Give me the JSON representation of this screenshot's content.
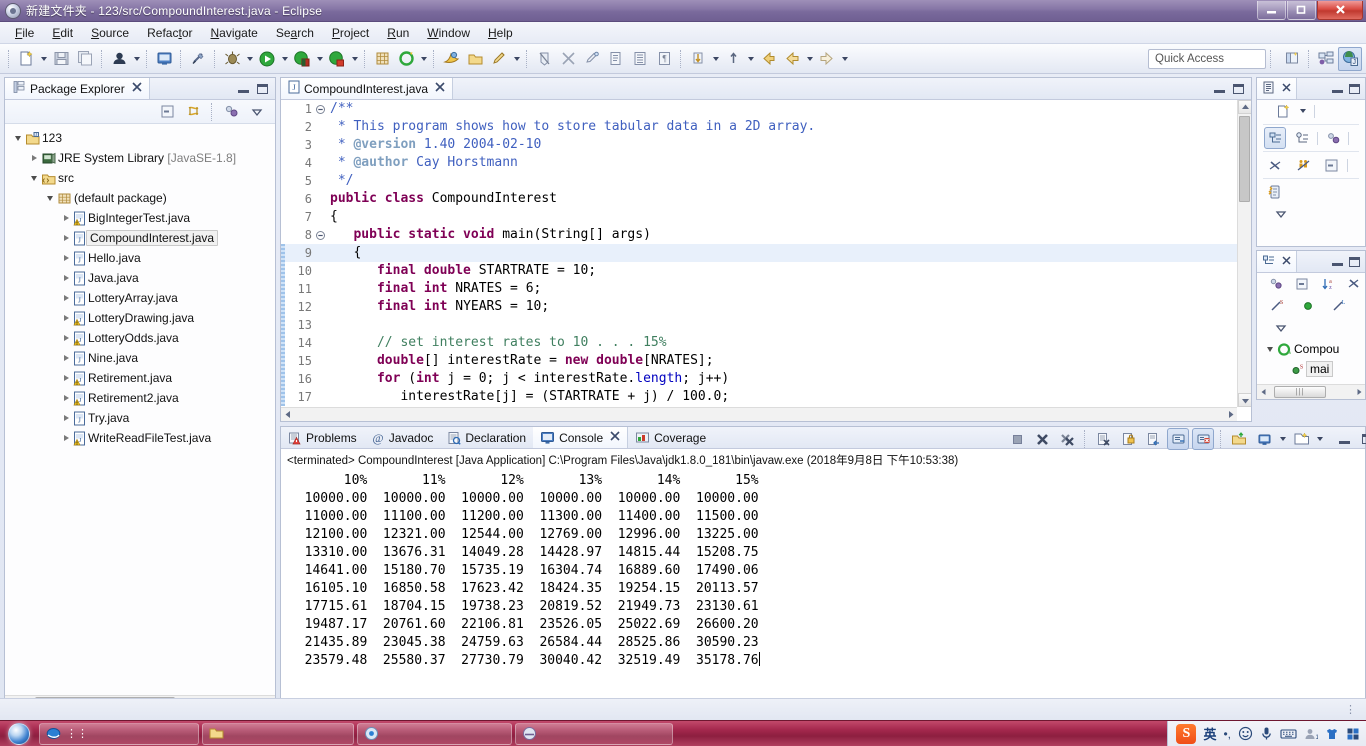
{
  "window": {
    "title": "新建文件夹 - 123/src/CompoundInterest.java - Eclipse",
    "icon": "eclipse-icon",
    "minimize_label": "—",
    "restore_label": "❐",
    "close_label": "✕"
  },
  "menubar": {
    "items": [
      {
        "label": "File",
        "mnemonic": "F"
      },
      {
        "label": "Edit",
        "mnemonic": "E"
      },
      {
        "label": "Source",
        "mnemonic": "S"
      },
      {
        "label": "Refactor",
        "mnemonic": "t"
      },
      {
        "label": "Navigate",
        "mnemonic": "N"
      },
      {
        "label": "Search",
        "mnemonic": "a"
      },
      {
        "label": "Project",
        "mnemonic": "P"
      },
      {
        "label": "Run",
        "mnemonic": "R"
      },
      {
        "label": "Window",
        "mnemonic": "W"
      },
      {
        "label": "Help",
        "mnemonic": "H"
      }
    ]
  },
  "toolbar": {
    "quick_access_placeholder": "Quick Access",
    "buttons": [
      "new-wizard-icon",
      "save-icon",
      "save-all-icon",
      "print-icon",
      "new-java-class-icon",
      "toggle-mark-occurrences-icon",
      "debug-icon",
      "run-icon",
      "run-coverage-icon",
      "run-external-tools-icon",
      "new-java-project-icon",
      "open-type-icon",
      "search-icon",
      "open-task-icon",
      "pencil-icon",
      "skip-breakpoints-icon",
      "next-annotation-icon",
      "previous-annotation-icon",
      "last-edit-location-icon",
      "back-icon",
      "forward-icon"
    ],
    "perspective_buttons": [
      "open-perspective-icon",
      "java-ee-perspective-icon",
      "java-perspective-icon"
    ]
  },
  "package_explorer": {
    "tab_label": "Package Explorer",
    "close_label": "✕",
    "toolbar_icons": [
      "collapse-all-icon",
      "link-with-editor-icon",
      "focus-on-active-task-icon",
      "view-menu-icon"
    ],
    "tree": [
      {
        "indent": 0,
        "twist": "open",
        "icon": "java-project-icon",
        "label": "123",
        "suffix": "",
        "selected": false
      },
      {
        "indent": 1,
        "twist": "closed",
        "icon": "jre-library-icon",
        "label": "JRE System Library",
        "suffix": " [JavaSE-1.8]",
        "selected": false
      },
      {
        "indent": 1,
        "twist": "open",
        "icon": "source-folder-icon",
        "label": "src",
        "suffix": "",
        "selected": false
      },
      {
        "indent": 2,
        "twist": "open",
        "icon": "package-icon",
        "label": "(default package)",
        "suffix": "",
        "selected": false
      },
      {
        "indent": 3,
        "twist": "closed",
        "icon": "java-file-warn-icon",
        "label": "BigIntegerTest.java",
        "suffix": "",
        "selected": false
      },
      {
        "indent": 3,
        "twist": "closed",
        "icon": "java-file-icon",
        "label": "CompoundInterest.java",
        "suffix": "",
        "selected": true
      },
      {
        "indent": 3,
        "twist": "closed",
        "icon": "java-file-icon",
        "label": "Hello.java",
        "suffix": "",
        "selected": false
      },
      {
        "indent": 3,
        "twist": "closed",
        "icon": "java-file-icon",
        "label": "Java.java",
        "suffix": "",
        "selected": false
      },
      {
        "indent": 3,
        "twist": "closed",
        "icon": "java-file-icon",
        "label": "LotteryArray.java",
        "suffix": "",
        "selected": false
      },
      {
        "indent": 3,
        "twist": "closed",
        "icon": "java-file-warn-icon",
        "label": "LotteryDrawing.java",
        "suffix": "",
        "selected": false
      },
      {
        "indent": 3,
        "twist": "closed",
        "icon": "java-file-warn-icon",
        "label": "LotteryOdds.java",
        "suffix": "",
        "selected": false
      },
      {
        "indent": 3,
        "twist": "closed",
        "icon": "java-file-icon",
        "label": "Nine.java",
        "suffix": "",
        "selected": false
      },
      {
        "indent": 3,
        "twist": "closed",
        "icon": "java-file-warn-icon",
        "label": "Retirement.java",
        "suffix": "",
        "selected": false
      },
      {
        "indent": 3,
        "twist": "closed",
        "icon": "java-file-warn-icon",
        "label": "Retirement2.java",
        "suffix": "",
        "selected": false
      },
      {
        "indent": 3,
        "twist": "closed",
        "icon": "java-file-icon",
        "label": "Try.java",
        "suffix": "",
        "selected": false
      },
      {
        "indent": 3,
        "twist": "closed",
        "icon": "java-file-warn-icon",
        "label": "WriteReadFileTest.java",
        "suffix": "",
        "selected": false
      }
    ]
  },
  "editor": {
    "tab_label": "CompoundInterest.java",
    "tab_icon": "java-file-icon",
    "close_label": "✕",
    "minimize_label": "—",
    "maximize_label": "❐",
    "lines": [
      {
        "num": 1,
        "fold": "minus",
        "hl": false,
        "tokens": [
          {
            "t": "/**",
            "c": "jd"
          }
        ]
      },
      {
        "num": 2,
        "fold": "",
        "hl": false,
        "tokens": [
          {
            "t": " * This program shows how to store tabular data in a 2D array.",
            "c": "jd"
          }
        ]
      },
      {
        "num": 3,
        "fold": "",
        "hl": false,
        "tokens": [
          {
            "t": " * ",
            "c": "jd"
          },
          {
            "t": "@version",
            "c": "jt"
          },
          {
            "t": " 1.40 2004-02-10",
            "c": "jd"
          }
        ]
      },
      {
        "num": 4,
        "fold": "",
        "hl": false,
        "tokens": [
          {
            "t": " * ",
            "c": "jd"
          },
          {
            "t": "@author",
            "c": "jt"
          },
          {
            "t": " Cay Horstmann",
            "c": "jd"
          }
        ]
      },
      {
        "num": 5,
        "fold": "",
        "hl": false,
        "tokens": [
          {
            "t": " */",
            "c": "jd"
          }
        ]
      },
      {
        "num": 6,
        "fold": "",
        "hl": false,
        "tokens": [
          {
            "t": "public class",
            "c": "k"
          },
          {
            "t": " CompoundInterest",
            "c": ""
          }
        ]
      },
      {
        "num": 7,
        "fold": "",
        "hl": false,
        "tokens": [
          {
            "t": "{",
            "c": ""
          }
        ]
      },
      {
        "num": 8,
        "fold": "minus",
        "hl": false,
        "tokens": [
          {
            "t": "   ",
            "c": ""
          },
          {
            "t": "public static void",
            "c": "k"
          },
          {
            "t": " main(String[] args)",
            "c": ""
          }
        ]
      },
      {
        "num": 9,
        "fold": "",
        "hl": true,
        "tokens": [
          {
            "t": "   {",
            "c": ""
          }
        ]
      },
      {
        "num": 10,
        "fold": "",
        "hl": false,
        "tokens": [
          {
            "t": "      ",
            "c": ""
          },
          {
            "t": "final double",
            "c": "k"
          },
          {
            "t": " STARTRATE = 10;",
            "c": ""
          }
        ]
      },
      {
        "num": 11,
        "fold": "",
        "hl": false,
        "tokens": [
          {
            "t": "      ",
            "c": ""
          },
          {
            "t": "final int",
            "c": "k"
          },
          {
            "t": " NRATES = 6;",
            "c": ""
          }
        ]
      },
      {
        "num": 12,
        "fold": "",
        "hl": false,
        "tokens": [
          {
            "t": "      ",
            "c": ""
          },
          {
            "t": "final int",
            "c": "k"
          },
          {
            "t": " NYEARS = 10;",
            "c": ""
          }
        ]
      },
      {
        "num": 13,
        "fold": "",
        "hl": false,
        "tokens": [
          {
            "t": "",
            "c": ""
          }
        ]
      },
      {
        "num": 14,
        "fold": "",
        "hl": false,
        "tokens": [
          {
            "t": "      ",
            "c": ""
          },
          {
            "t": "// set interest rates to 10 . . . 15%",
            "c": "cm"
          }
        ]
      },
      {
        "num": 15,
        "fold": "",
        "hl": false,
        "tokens": [
          {
            "t": "      ",
            "c": ""
          },
          {
            "t": "double",
            "c": "k"
          },
          {
            "t": "[] interestRate = ",
            "c": ""
          },
          {
            "t": "new double",
            "c": "k"
          },
          {
            "t": "[NRATES];",
            "c": ""
          }
        ]
      },
      {
        "num": 16,
        "fold": "",
        "hl": false,
        "tokens": [
          {
            "t": "      ",
            "c": ""
          },
          {
            "t": "for",
            "c": "k"
          },
          {
            "t": " (",
            "c": ""
          },
          {
            "t": "int",
            "c": "k"
          },
          {
            "t": " j = 0; j < interestRate.",
            "c": ""
          },
          {
            "t": "length",
            "c": "fl"
          },
          {
            "t": "; j++)",
            "c": ""
          }
        ]
      },
      {
        "num": 17,
        "fold": "",
        "hl": false,
        "tokens": [
          {
            "t": "         interestRate[j] = (STARTRATE + j) / 100.0;",
            "c": ""
          }
        ]
      }
    ]
  },
  "bottom_panel": {
    "tabs": [
      {
        "label": "Problems",
        "icon": "problems-icon",
        "active": false
      },
      {
        "label": "Javadoc",
        "icon": "javadoc-icon",
        "active": false
      },
      {
        "label": "Declaration",
        "icon": "declaration-icon",
        "active": false
      },
      {
        "label": "Console",
        "icon": "console-icon",
        "active": true
      },
      {
        "label": "Coverage",
        "icon": "coverage-icon",
        "active": false
      }
    ],
    "toolbar_icons": [
      "terminate-icon",
      "remove-launch-icon",
      "remove-all-terminated-icon",
      "clear-console-icon",
      "scroll-lock-icon",
      "word-wrap-icon",
      "pin-console-icon",
      "display-selected-console-icon",
      "open-console-icon",
      "new-console-view-icon",
      "minimize-icon",
      "maximize-icon"
    ],
    "console_header": "<terminated> CompoundInterest [Java Application] C:\\Program Files\\Java\\jdk1.8.0_181\\bin\\javaw.exe (2018年9月8日 下午10:53:38)"
  },
  "console_output": {
    "type": "table",
    "columns": [
      "10%",
      "11%",
      "12%",
      "13%",
      "14%",
      "15%"
    ],
    "rows": [
      [
        "10000.00",
        "10000.00",
        "10000.00",
        "10000.00",
        "10000.00",
        "10000.00"
      ],
      [
        "11000.00",
        "11100.00",
        "11200.00",
        "11300.00",
        "11400.00",
        "11500.00"
      ],
      [
        "12100.00",
        "12321.00",
        "12544.00",
        "12769.00",
        "12996.00",
        "13225.00"
      ],
      [
        "13310.00",
        "13676.31",
        "14049.28",
        "14428.97",
        "14815.44",
        "15208.75"
      ],
      [
        "14641.00",
        "15180.70",
        "15735.19",
        "16304.74",
        "16889.60",
        "17490.06"
      ],
      [
        "16105.10",
        "16850.58",
        "17623.42",
        "18424.35",
        "19254.15",
        "20113.57"
      ],
      [
        "17715.61",
        "18704.15",
        "19738.23",
        "20819.52",
        "21949.73",
        "23130.61"
      ],
      [
        "19487.17",
        "20761.60",
        "22106.81",
        "23526.05",
        "25022.69",
        "26600.20"
      ],
      [
        "21435.89",
        "23045.38",
        "24759.63",
        "26584.44",
        "28525.86",
        "30590.23"
      ],
      [
        "23579.48",
        "25580.37",
        "27730.79",
        "30040.42",
        "32519.49",
        "35178.76"
      ]
    ]
  },
  "right_panels": {
    "outline": {
      "tab_icon": "outline-icon",
      "close_label": "✕",
      "minimize_label": "—",
      "maximize_label": "❐",
      "toolbar_icons": [
        "new-icon",
        "alphabetical-sort-icon",
        "hide-fields-icon",
        "hide-static-icon",
        "hide-non-public-icon",
        "hide-local-types-icon",
        "focus-icon",
        "view-menu-icon"
      ]
    },
    "outline_tree": {
      "tab_icon": "outline2-icon",
      "close_label": "✕",
      "minimize_label": "—",
      "maximize_label": "❐",
      "toolbar_icons": [
        "link-icon",
        "collapse-icon",
        "sort-icon",
        "filter-icon",
        "static-icon",
        "public-icon",
        "local-icon"
      ],
      "nodes": [
        {
          "indent": 0,
          "twist": "open",
          "icon": "class-icon",
          "label": "Compou"
        },
        {
          "indent": 1,
          "twist": "none",
          "icon": "method-icon",
          "label": "mai",
          "badge": "S"
        }
      ]
    },
    "hscroll_present": true
  },
  "statusbar": {
    "dots": "⋮"
  },
  "taskbar": {
    "start_label": "start-orb",
    "items": [
      {
        "icon": "ie-icon",
        "label": ""
      },
      {
        "icon": "folder-icon",
        "label": ""
      },
      {
        "icon": "chrome-icon",
        "label": ""
      },
      {
        "icon": "eclipse-icon",
        "label": ""
      }
    ],
    "tray": [
      {
        "icon": "sogou-icon",
        "label": "S"
      },
      {
        "icon": "ime-chinese-icon",
        "label": "英"
      },
      {
        "icon": "ime-punct-icon",
        "label": "•,"
      },
      {
        "icon": "emoji-icon",
        "label": "☺"
      },
      {
        "icon": "microphone-icon",
        "label": "🎤"
      },
      {
        "icon": "keyboard-icon",
        "label": "⌨"
      },
      {
        "icon": "user-icon",
        "label": "👤"
      },
      {
        "icon": "skin-icon",
        "label": "👕"
      },
      {
        "icon": "toolbox-icon",
        "label": "▦"
      }
    ]
  },
  "colors": {
    "title_bar": "#7a6a9c",
    "accent": "#6f5f92",
    "taskbar": "#a4284d",
    "keyword": "#7f0055",
    "comment": "#3f7f5f",
    "javadoc": "#3f5fbf",
    "field": "#0000c0",
    "selection": "#e8f0fb"
  }
}
